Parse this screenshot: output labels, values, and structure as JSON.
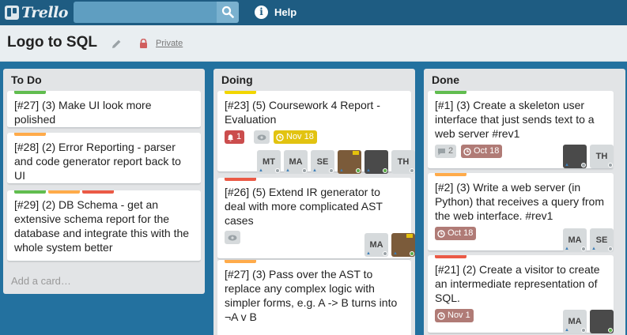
{
  "app": {
    "logo_text": "Trello"
  },
  "header": {
    "search_placeholder": "",
    "help_label": "Help"
  },
  "board": {
    "title": "Logo to SQL",
    "privacy": "Private"
  },
  "colors": {
    "green": "#61bd4f",
    "yellow": "#f2d600",
    "orange": "#ffab4a",
    "red": "#eb5a46"
  },
  "lists": [
    {
      "title": "To Do",
      "add_card": "Add a card…",
      "cards": [
        {
          "text": "[#27] (3) Make UI look more polished",
          "labels": [
            "green"
          ]
        },
        {
          "text": "[#28] (2) Error Reporting - parser and code generator report back to UI",
          "labels": [
            "orange"
          ]
        },
        {
          "text": "[#29] (2) DB Schema - get an extensive schema report for the database and integrate this with the whole system better",
          "labels": [
            "green",
            "orange",
            "red"
          ]
        }
      ]
    },
    {
      "title": "Doing",
      "cards": [
        {
          "text": "[#23] (5) Coursework 4 Report - Evaluation",
          "labels": [
            "yellow"
          ],
          "badges": {
            "notification": "1",
            "due": "Nov 18"
          },
          "members": [
            "MT",
            "MA",
            "SE",
            "photo",
            "photo",
            "TH"
          ]
        },
        {
          "text": "[#26] (5) Extend IR generator to deal with more complicated AST cases",
          "labels": [
            "red"
          ],
          "members": [
            "MA",
            "photo"
          ]
        },
        {
          "text": "[#27] (3) Pass over the AST to replace any complex logic with simpler forms, e.g. A -> B turns into ¬A v B",
          "labels": [
            "orange"
          ]
        }
      ]
    },
    {
      "title": "Done",
      "cards": [
        {
          "text": "[#1] (3) Create a skeleton user interface that just sends text to a web server #rev1",
          "labels": [
            "green"
          ],
          "badges": {
            "comments": "2",
            "due": "Oct 18"
          },
          "members": [
            "photo",
            "TH"
          ]
        },
        {
          "text": "[#2] (3) Write a web server (in Python) that receives a query from the web interface. #rev1",
          "labels": [
            "orange"
          ],
          "badges": {
            "due": "Oct 18"
          },
          "members": [
            "MA",
            "SE"
          ]
        },
        {
          "text": "[#21] (2) Create a visitor to create an intermediate representation of SQL.",
          "labels": [
            "red"
          ],
          "badges": {
            "due": "Nov 1"
          },
          "members": [
            "MA",
            "photo"
          ]
        }
      ]
    }
  ]
}
